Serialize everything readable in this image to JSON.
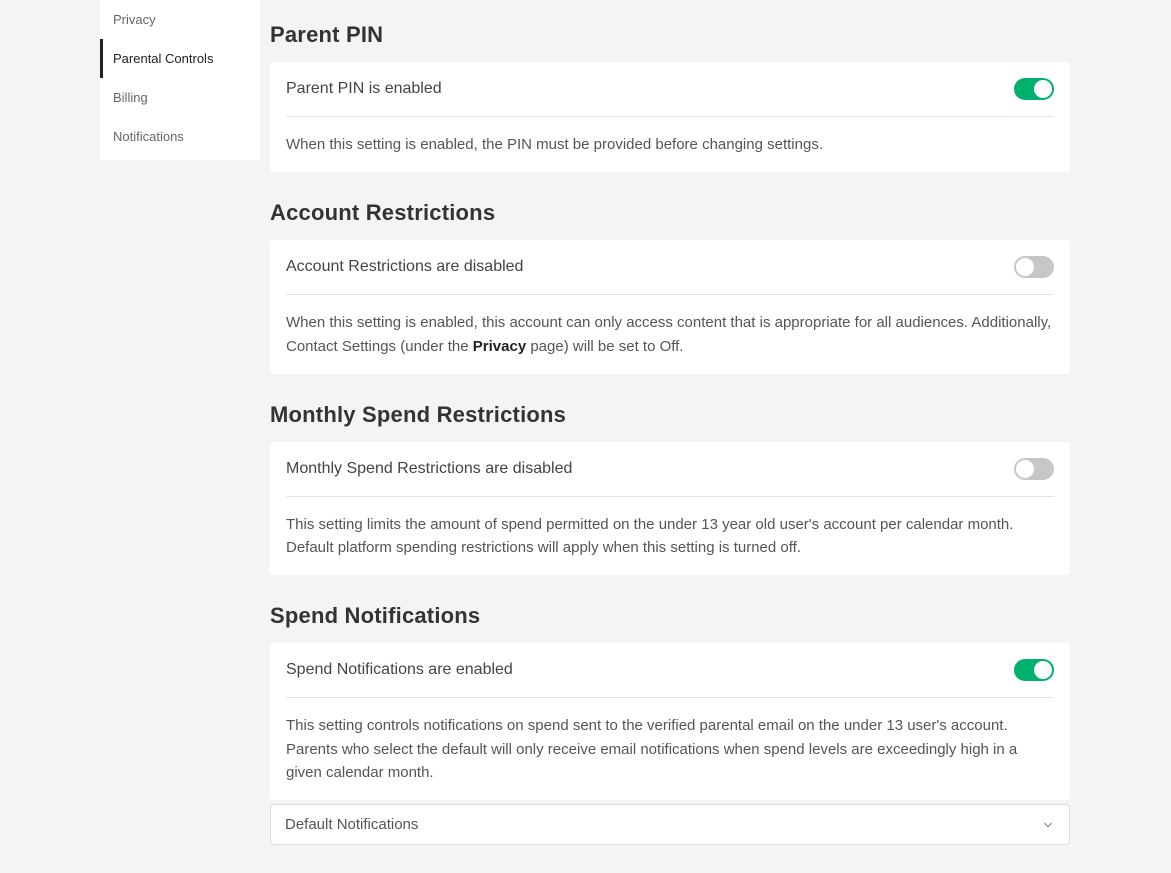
{
  "sidebar": {
    "items": [
      {
        "label": "Privacy",
        "active": false
      },
      {
        "label": "Parental Controls",
        "active": true
      },
      {
        "label": "Billing",
        "active": false
      },
      {
        "label": "Notifications",
        "active": false
      }
    ]
  },
  "sections": {
    "parentPin": {
      "heading": "Parent PIN",
      "toggleLabel": "Parent PIN is enabled",
      "toggleOn": true,
      "description": "When this setting is enabled, the PIN must be provided before changing settings."
    },
    "accountRestrictions": {
      "heading": "Account Restrictions",
      "toggleLabel": "Account Restrictions are disabled",
      "toggleOn": false,
      "description_pre": "When this setting is enabled, this account can only access content that is appropriate for all audiences. Additionally, Contact Settings (under the ",
      "description_bold": "Privacy",
      "description_post": " page) will be set to Off."
    },
    "monthlySpend": {
      "heading": "Monthly Spend Restrictions",
      "toggleLabel": "Monthly Spend Restrictions are disabled",
      "toggleOn": false,
      "description": "This setting limits the amount of spend permitted on the under 13 year old user's account per calendar month. Default platform spending restrictions will apply when this setting is turned off."
    },
    "spendNotifications": {
      "heading": "Spend Notifications",
      "toggleLabel": "Spend Notifications are enabled",
      "toggleOn": true,
      "description": "This setting controls notifications on spend sent to the verified parental email on the under 13 user's account. Parents who select the default will only receive email notifications when spend levels are exceedingly high in a given calendar month.",
      "dropdownSelected": "Default Notifications"
    }
  }
}
